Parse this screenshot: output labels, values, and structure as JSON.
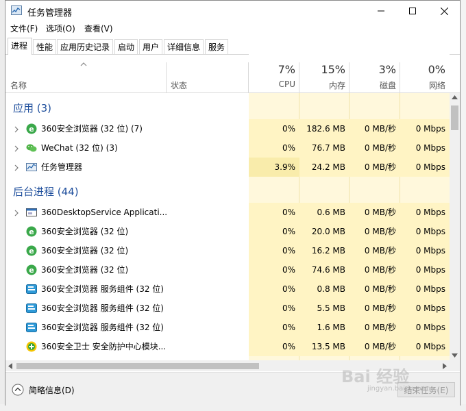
{
  "window": {
    "title": "任务管理器"
  },
  "menu": [
    "文件(F)",
    "选项(O)",
    "查看(V)"
  ],
  "tabs": [
    "进程",
    "性能",
    "应用历史记录",
    "启动",
    "用户",
    "详细信息",
    "服务"
  ],
  "columns": {
    "name": "名称",
    "status": "状态",
    "cpu": {
      "pct": "7%",
      "label": "CPU"
    },
    "mem": {
      "pct": "15%",
      "label": "内存"
    },
    "disk": {
      "pct": "3%",
      "label": "磁盘"
    },
    "net": {
      "pct": "0%",
      "label": "网络"
    }
  },
  "groups": {
    "apps": "应用 (3)",
    "background": "后台进程 (44)"
  },
  "apps": [
    {
      "name": "360安全浏览器 (32 位) (7)",
      "cpu": "0%",
      "mem": "182.6 MB",
      "disk": "0 MB/秒",
      "net": "0 Mbps",
      "icon": "360-browser-icon",
      "expandable": true
    },
    {
      "name": "WeChat (32 位) (3)",
      "cpu": "0%",
      "mem": "76.7 MB",
      "disk": "0 MB/秒",
      "net": "0 Mbps",
      "icon": "wechat-icon",
      "expandable": true
    },
    {
      "name": "任务管理器",
      "cpu": "3.9%",
      "mem": "24.2 MB",
      "disk": "0 MB/秒",
      "net": "0 Mbps",
      "icon": "task-manager-icon",
      "expandable": true
    }
  ],
  "background": [
    {
      "name": "360DesktopService Applicati...",
      "cpu": "0%",
      "mem": "0.6 MB",
      "disk": "0 MB/秒",
      "net": "0 Mbps",
      "icon": "service-app-icon",
      "expandable": true
    },
    {
      "name": "360安全浏览器 (32 位)",
      "cpu": "0%",
      "mem": "20.0 MB",
      "disk": "0 MB/秒",
      "net": "0 Mbps",
      "icon": "360-browser-icon",
      "expandable": false
    },
    {
      "name": "360安全浏览器 (32 位)",
      "cpu": "0%",
      "mem": "16.2 MB",
      "disk": "0 MB/秒",
      "net": "0 Mbps",
      "icon": "360-browser-icon",
      "expandable": false
    },
    {
      "name": "360安全浏览器 (32 位)",
      "cpu": "0%",
      "mem": "74.6 MB",
      "disk": "0 MB/秒",
      "net": "0 Mbps",
      "icon": "360-browser-icon",
      "expandable": false
    },
    {
      "name": "360安全浏览器 服务组件 (32 位)",
      "cpu": "0%",
      "mem": "0.8 MB",
      "disk": "0 MB/秒",
      "net": "0 Mbps",
      "icon": "360-service-icon",
      "expandable": false
    },
    {
      "name": "360安全浏览器 服务组件 (32 位)",
      "cpu": "0%",
      "mem": "5.5 MB",
      "disk": "0 MB/秒",
      "net": "0 Mbps",
      "icon": "360-service-icon",
      "expandable": false
    },
    {
      "name": "360安全浏览器 服务组件 (32 位)",
      "cpu": "0%",
      "mem": "1.6 MB",
      "disk": "0 MB/秒",
      "net": "0 Mbps",
      "icon": "360-service-icon",
      "expandable": false
    },
    {
      "name": "360安全卫士 安全防护中心模块...",
      "cpu": "0%",
      "mem": "13.5 MB",
      "disk": "0 MB/秒",
      "net": "0 Mbps",
      "icon": "360-safeguard-icon",
      "expandable": false
    }
  ],
  "footer": {
    "brief": "简略信息(D)",
    "end_task": "结束任务(E)"
  },
  "watermark": {
    "main": "Bai 经验",
    "sub": "jingyan.baidu.com"
  },
  "colors": {
    "accent_blue": "#1e4e9c",
    "cpu_highlight": "#f9ecab",
    "cell_yellow": "#fff4c4"
  }
}
